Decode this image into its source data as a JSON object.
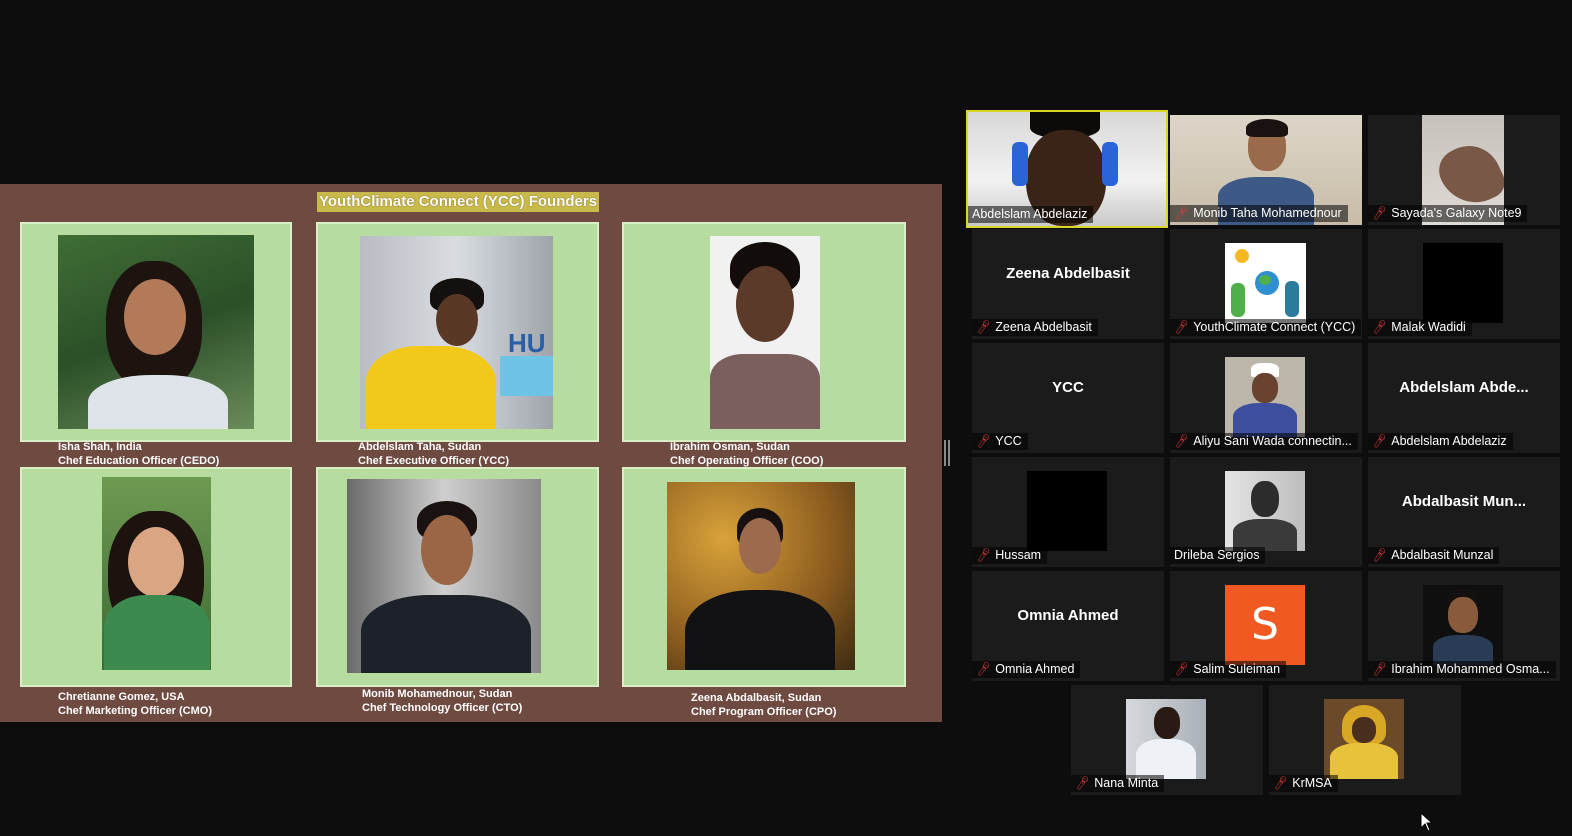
{
  "slide": {
    "title": "YouthClimate Connect (YCC) Founders",
    "founders": [
      {
        "name_line": "Isha Shah, India",
        "role": "Chef Education Officer (CEDO)"
      },
      {
        "name_line": "Abdelslam Taha, Sudan",
        "role": "Chef Executive Officer (YCC)"
      },
      {
        "name_line": "Ibrahim Osman, Sudan",
        "role": "Chef Operating Officer (COO)"
      },
      {
        "name_line": "Chretianne Gomez, USA",
        "role": "Chef Marketing Officer (CMO)"
      },
      {
        "name_line": "Monib Mohamednour, Sudan",
        "role": "Chef Technology Officer (CTO)"
      },
      {
        "name_line": "Zeena Abdalbasit, Sudan",
        "role": "Chef Program Officer (CPO)"
      }
    ],
    "photo_text": "HU"
  },
  "gallery": {
    "tiles": [
      {
        "name": "Abdelslam Abdelaziz",
        "muted": false,
        "active": true,
        "center": ""
      },
      {
        "name": "Monib Taha Mohamednour",
        "muted": true,
        "active": false,
        "center": ""
      },
      {
        "name": "Sayada's Galaxy Note9",
        "muted": true,
        "active": false,
        "center": ""
      },
      {
        "name": "Zeena Abdelbasit",
        "muted": true,
        "active": false,
        "center": "Zeena Abdelbasit"
      },
      {
        "name": "YouthClimate Connect (YCC)",
        "muted": true,
        "active": false,
        "center": ""
      },
      {
        "name": "Malak Wadidi",
        "muted": true,
        "active": false,
        "center": ""
      },
      {
        "name": "YCC",
        "muted": true,
        "active": false,
        "center": "YCC"
      },
      {
        "name": "Aliyu Sani Wada connectin...",
        "muted": true,
        "active": false,
        "center": ""
      },
      {
        "name": "Abdelslam Abdelaziz",
        "muted": true,
        "active": false,
        "center": "Abdelslam  Abde..."
      },
      {
        "name": "Hussam",
        "muted": true,
        "active": false,
        "center": ""
      },
      {
        "name": "Drileba Sergios",
        "muted": false,
        "active": false,
        "center": ""
      },
      {
        "name": "Abdalbasit Munzal",
        "muted": true,
        "active": false,
        "center": "Abdalbasit  Mun..."
      },
      {
        "name": "Omnia Ahmed",
        "muted": true,
        "active": false,
        "center": "Omnia Ahmed"
      },
      {
        "name": "Salim Suleiman",
        "muted": true,
        "active": false,
        "center": ""
      },
      {
        "name": "Ibrahim Mohammed Osma...",
        "muted": true,
        "active": false,
        "center": ""
      },
      {
        "name": "Nana Minta",
        "muted": true,
        "active": false,
        "center": ""
      },
      {
        "name": "KrMSA",
        "muted": true,
        "active": false,
        "center": ""
      }
    ],
    "salim_avatar_letter": "S",
    "mute_icon": "microphone-muted-icon"
  },
  "colors": {
    "slide_bg": "#6e4a40",
    "card_bg": "#b6dc9f",
    "title_bg": "#c9b84a",
    "active_border": "#d9d62a",
    "mute_red": "#e23b3b",
    "salim_orange": "#f05a22"
  }
}
